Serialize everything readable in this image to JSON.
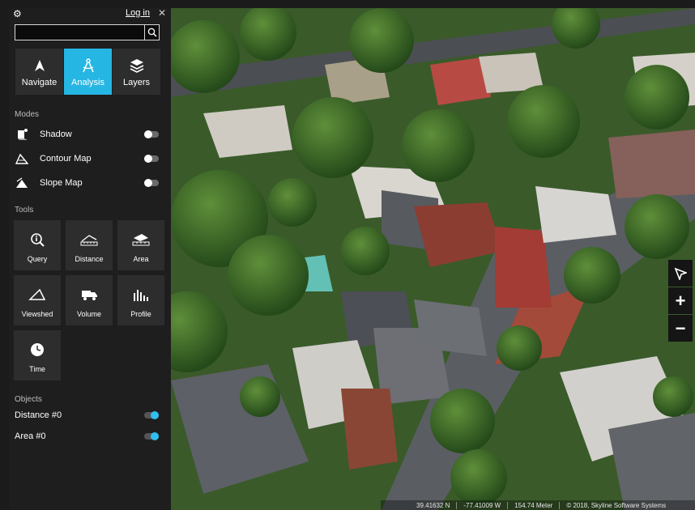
{
  "topbar": {
    "login_label": "Log in"
  },
  "search": {
    "placeholder": ""
  },
  "main_tabs": [
    {
      "label": "Navigate",
      "icon": "navigate-arrow-icon"
    },
    {
      "label": "Analysis",
      "icon": "compass-icon",
      "active": true
    },
    {
      "label": "Layers",
      "icon": "layers-icon"
    }
  ],
  "modes": {
    "title": "Modes",
    "items": [
      {
        "label": "Shadow",
        "icon": "shadow-icon",
        "on": false
      },
      {
        "label": "Contour Map",
        "icon": "contour-map-icon",
        "on": false
      },
      {
        "label": "Slope Map",
        "icon": "slope-map-icon",
        "on": false
      }
    ]
  },
  "tools": {
    "title": "Tools",
    "items": [
      {
        "label": "Query",
        "icon": "query-icon"
      },
      {
        "label": "Distance",
        "icon": "distance-icon"
      },
      {
        "label": "Area",
        "icon": "area-icon"
      },
      {
        "label": "Viewshed",
        "icon": "viewshed-icon"
      },
      {
        "label": "Volume",
        "icon": "volume-icon"
      },
      {
        "label": "Profile",
        "icon": "profile-icon"
      },
      {
        "label": "Time",
        "icon": "clock-icon"
      }
    ]
  },
  "objects": {
    "title": "Objects",
    "items": [
      {
        "label": "Distance #0",
        "on": true
      },
      {
        "label": "Area #0",
        "on": true
      }
    ]
  },
  "status": {
    "lat": "39.41632 N",
    "lon": "-77.41009 W",
    "altitude": "154.74 Meter",
    "copyright": "© 2018, Skyline Software Systems"
  },
  "colors": {
    "accent": "#26b6e3",
    "panel": "#1e1e1e",
    "tile": "#2d2d2d"
  }
}
